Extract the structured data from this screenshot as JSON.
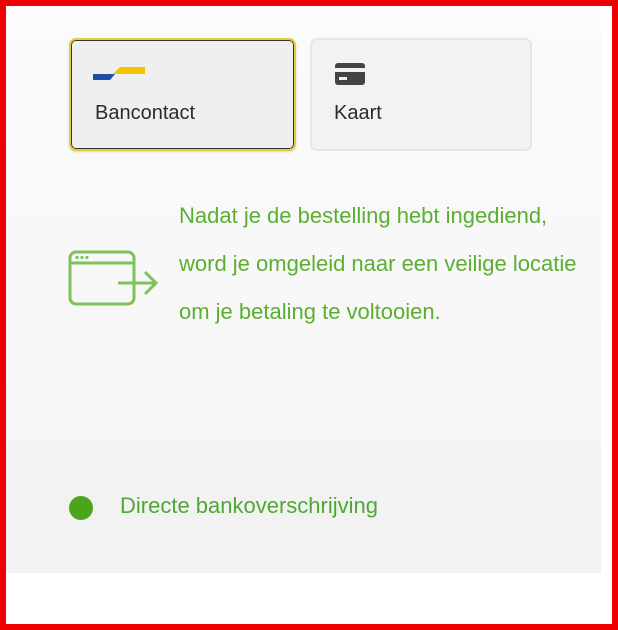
{
  "payment_methods": [
    {
      "label": "Bancontact",
      "icon": "bancontact-logo-icon",
      "selected": true
    },
    {
      "label": "Kaart",
      "icon": "credit-card-icon",
      "selected": false
    }
  ],
  "redirect_notice": {
    "text": "Nadat je de bestelling hebt ingediend, word je omgeleid naar een veilige locatie om je betaling te voltooien.",
    "icon": "browser-redirect-icon"
  },
  "option": {
    "label": "Directe bankoverschrijving",
    "indicator": "status-dot"
  },
  "colors": {
    "frame": "#ee0000",
    "accent_green": "#5cae32",
    "selected_border": "#e8cc33",
    "bancontact_blue": "#1e4ea8",
    "bancontact_yellow": "#f5c400"
  }
}
